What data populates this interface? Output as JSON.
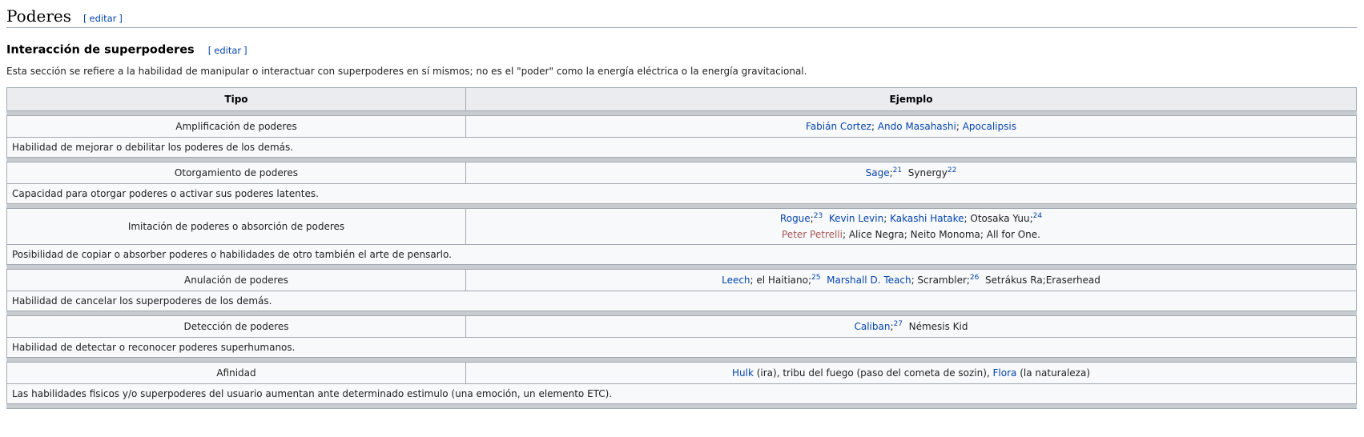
{
  "section": {
    "title": "Poderes",
    "edit": "editar"
  },
  "subsection": {
    "title": "Interacción de superpoderes",
    "edit": "editar"
  },
  "intro": "Esta sección se refiere a la habilidad de manipular o interactuar con superpoderes en sí mismos; no es el \"poder\" como la energía eléctrica o la energía gravitacional.",
  "table": {
    "headers": {
      "tipo": "Tipo",
      "ejemplo": "Ejemplo"
    },
    "rows": [
      {
        "tipo": "Amplificación de poderes",
        "examples": [
          {
            "text": "Fabián Cortez",
            "kind": "link"
          },
          {
            "text": "; ",
            "kind": "text"
          },
          {
            "text": "Ando Masahashi",
            "kind": "link"
          },
          {
            "text": "; ",
            "kind": "text"
          },
          {
            "text": "Apocalipsis",
            "kind": "link"
          }
        ],
        "desc": "Habilidad de mejorar o debilitar los poderes de los demás."
      },
      {
        "tipo": "Otorgamiento de poderes",
        "examples": [
          {
            "text": "Sage",
            "kind": "link"
          },
          {
            "text": ";",
            "kind": "text"
          },
          {
            "text": "21",
            "kind": "sup"
          },
          {
            "text": "  Synergy",
            "kind": "text"
          },
          {
            "text": "22",
            "kind": "sup"
          }
        ],
        "desc": "Capacidad para otorgar poderes o activar sus poderes latentes."
      },
      {
        "tipo": "Imitación de poderes o absorción de poderes",
        "examples": [
          {
            "text": "Rogue",
            "kind": "link"
          },
          {
            "text": ";",
            "kind": "text"
          },
          {
            "text": "23",
            "kind": "sup"
          },
          {
            "text": "  ",
            "kind": "text"
          },
          {
            "text": "Kevin Levin",
            "kind": "link"
          },
          {
            "text": "; ",
            "kind": "text"
          },
          {
            "text": "Kakashi Hatake",
            "kind": "link"
          },
          {
            "text": "; Otosaka Yuu;",
            "kind": "text"
          },
          {
            "text": "24",
            "kind": "sup"
          },
          {
            "text": "",
            "kind": "br"
          },
          {
            "text": "Peter Petrelli",
            "kind": "new"
          },
          {
            "text": "; Alice Negra; Neito Monoma; All for One.",
            "kind": "text"
          }
        ],
        "desc": "Posibilidad de copiar o absorber poderes o habilidades de otro también el arte de pensarlo."
      },
      {
        "tipo": "Anulación de poderes",
        "examples": [
          {
            "text": "Leech",
            "kind": "link"
          },
          {
            "text": "; el Haitiano;",
            "kind": "text"
          },
          {
            "text": "25",
            "kind": "sup"
          },
          {
            "text": "  ",
            "kind": "text"
          },
          {
            "text": "Marshall D. Teach",
            "kind": "link"
          },
          {
            "text": "; Scrambler;",
            "kind": "text"
          },
          {
            "text": "26",
            "kind": "sup"
          },
          {
            "text": "  Setrákus Ra;Eraserhead",
            "kind": "text"
          }
        ],
        "desc": "Habilidad de cancelar los superpoderes de los demás."
      },
      {
        "tipo": "Detección de poderes",
        "examples": [
          {
            "text": "Caliban",
            "kind": "link"
          },
          {
            "text": ";",
            "kind": "text"
          },
          {
            "text": "27",
            "kind": "sup"
          },
          {
            "text": "  Némesis Kid",
            "kind": "text"
          }
        ],
        "desc": "Habilidad de detectar o reconocer poderes superhumanos."
      },
      {
        "tipo": "Afinidad",
        "examples": [
          {
            "text": "Hulk",
            "kind": "link"
          },
          {
            "text": " (ira), tribu del fuego (paso del cometa de sozin), ",
            "kind": "text"
          },
          {
            "text": "Flora",
            "kind": "link"
          },
          {
            "text": " (la naturaleza)",
            "kind": "text"
          }
        ],
        "desc": "Las habilidades fisicos y/o superpoderes del usuario aumentan ante determinado estimulo (una emoción, un elemento ETC)."
      }
    ]
  }
}
